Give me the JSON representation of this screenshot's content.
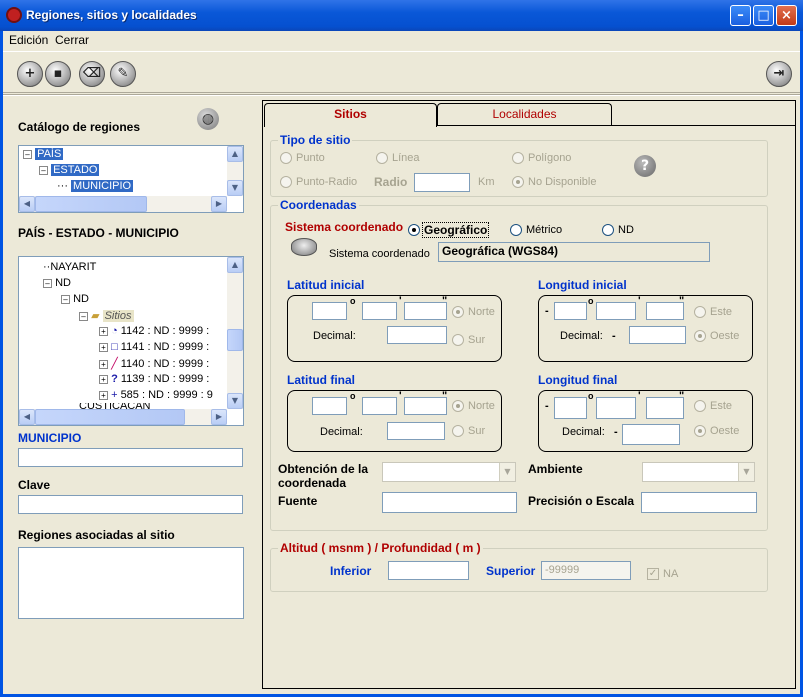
{
  "window": {
    "title": "Regiones, sitios y localidades"
  },
  "menu": [
    "Edición",
    "Cerrar"
  ],
  "left": {
    "catalog_label": "Catálogo de regiones",
    "catalog_tree": [
      "PAÍS",
      "ESTADO",
      "MUNICIPIO"
    ],
    "path_label": "PAÍS - ESTADO - MUNICIPIO",
    "tree": {
      "nayarit": "NAYARIT",
      "nd1": "ND",
      "nd2": "ND",
      "sitios": "Sitios",
      "items": [
        "1142 : ND : 9999 :",
        "1141 : ND : 9999 :",
        "1140 : ND : 9999 :",
        "1139 : ND : 9999 :",
        "585 : ND : 9999 : 9"
      ],
      "cut": "CUSTICACÁN"
    },
    "municipio_label": "MUNICIPIO",
    "clave_label": "Clave",
    "regiones_label": "Regiones asociadas al sitio"
  },
  "tabs": {
    "sitios": "Sitios",
    "localidades": "Localidades"
  },
  "tipo_sitio": {
    "label": "Tipo de sitio",
    "punto": "Punto",
    "linea": "Línea",
    "poligono": "Polígono",
    "punto_radio": "Punto-Radio",
    "radio": "Radio",
    "km": "Km",
    "no_disponible": "No Disponible"
  },
  "coordenadas": {
    "label": "Coordenadas",
    "sistema_label": "Sistema coordenado",
    "geografico": "Geográfico",
    "metrico": "Métrico",
    "nd": "ND",
    "sistema_small": "Sistema coordenado",
    "sistema_value": "Geográfica (WGS84)",
    "lat_ini": "Latitud inicial",
    "lon_ini": "Longitud inicial",
    "lat_fin": "Latitud final",
    "lon_fin": "Longitud final",
    "norte": "Norte",
    "sur": "Sur",
    "este": "Este",
    "oeste": "Oeste",
    "decimal": "Decimal:",
    "deg": "o",
    "min": "'",
    "sec": "\"",
    "minus": "-"
  },
  "obtencion": {
    "label_1": "Obtención de la",
    "label_2": "coordenada",
    "ambiente": "Ambiente",
    "fuente": "Fuente",
    "precision": "Precisión o Escala"
  },
  "altitud": {
    "label": "Altitud ( msnm ) / Profundidad ( m )",
    "inferior": "Inferior",
    "superior": "Superior",
    "superior_value": "-99999",
    "na": "NA"
  }
}
